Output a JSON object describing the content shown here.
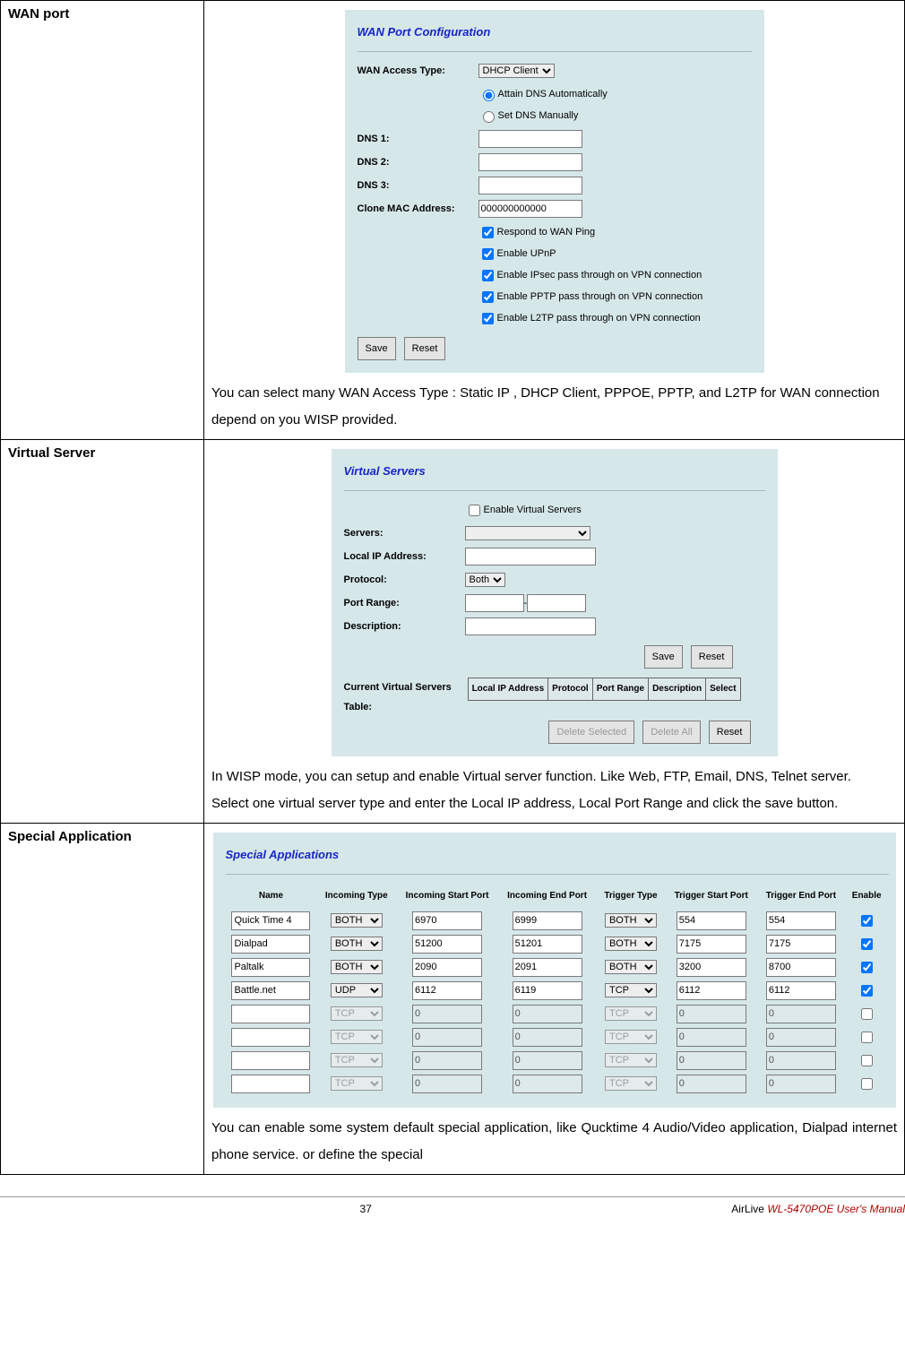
{
  "rows": [
    {
      "label": "WAN port",
      "desc": "You can select many WAN Access Type : Static IP , DHCP Client, PPPOE, PPTP, and L2TP for WAN connection depend on you WISP provided."
    },
    {
      "label": "Virtual Server",
      "desc1": "In WISP mode, you can setup and enable Virtual server function. Like Web, FTP, Email, DNS, Telnet server.",
      "desc2": "Select one virtual server type and enter the Local IP address, Local Port Range and click the save button."
    },
    {
      "label": "Special Application",
      "desc": "You can enable some system default special application, like Qucktime 4 Audio/Video application, Dialpad internet phone service. or define the special"
    }
  ],
  "wan": {
    "title": "WAN Port Configuration",
    "access_label": "WAN Access Type:",
    "access_value": "DHCP Client",
    "radio_auto": "Attain DNS Automatically",
    "radio_manual": "Set DNS Manually",
    "dns1": "DNS 1:",
    "dns2": "DNS 2:",
    "dns3": "DNS 3:",
    "clone_label": "Clone MAC Address:",
    "clone_value": "000000000000",
    "chk1": "Respond to WAN Ping",
    "chk2": "Enable UPnP",
    "chk3": "Enable IPsec pass through on VPN connection",
    "chk4": "Enable PPTP pass through on VPN connection",
    "chk5": "Enable L2TP pass through on VPN connection",
    "save": "Save",
    "reset": "Reset"
  },
  "vs": {
    "title": "Virtual Servers",
    "enable": "Enable Virtual Servers",
    "servers": "Servers:",
    "localip": "Local IP Address:",
    "protocol": "Protocol:",
    "protocol_value": "Both",
    "port": "Port Range:",
    "desc": "Description:",
    "save": "Save",
    "reset": "Reset",
    "table_label": "Current Virtual Servers Table:",
    "th1": "Local IP Address",
    "th2": "Protocol",
    "th3": "Port Range",
    "th4": "Description",
    "th5": "Select",
    "del_sel": "Delete Selected",
    "del_all": "Delete All",
    "reset2": "Reset"
  },
  "sa": {
    "title": "Special Applications",
    "h_name": "Name",
    "h_inc_type": "Incoming Type",
    "h_inc_start": "Incoming Start Port",
    "h_inc_end": "Incoming End Port",
    "h_trig_type": "Trigger Type",
    "h_trig_start": "Trigger Start Port",
    "h_trig_end": "Trigger End Port",
    "h_enable": "Enable",
    "rows": [
      {
        "name": "Quick Time 4",
        "itype": "BOTH",
        "istart": "6970",
        "iend": "6999",
        "ttype": "BOTH",
        "tstart": "554",
        "tend": "554",
        "en": true,
        "editable": true
      },
      {
        "name": "Dialpad",
        "itype": "BOTH",
        "istart": "51200",
        "iend": "51201",
        "ttype": "BOTH",
        "tstart": "7175",
        "tend": "7175",
        "en": true,
        "editable": true
      },
      {
        "name": "Paltalk",
        "itype": "BOTH",
        "istart": "2090",
        "iend": "2091",
        "ttype": "BOTH",
        "tstart": "3200",
        "tend": "8700",
        "en": true,
        "editable": true
      },
      {
        "name": "Battle.net",
        "itype": "UDP",
        "istart": "6112",
        "iend": "6119",
        "ttype": "TCP",
        "tstart": "6112",
        "tend": "6112",
        "en": true,
        "editable": true
      },
      {
        "name": "",
        "itype": "TCP",
        "istart": "0",
        "iend": "0",
        "ttype": "TCP",
        "tstart": "0",
        "tend": "0",
        "en": false,
        "editable": false
      },
      {
        "name": "",
        "itype": "TCP",
        "istart": "0",
        "iend": "0",
        "ttype": "TCP",
        "tstart": "0",
        "tend": "0",
        "en": false,
        "editable": false
      },
      {
        "name": "",
        "itype": "TCP",
        "istart": "0",
        "iend": "0",
        "ttype": "TCP",
        "tstart": "0",
        "tend": "0",
        "en": false,
        "editable": false
      },
      {
        "name": "",
        "itype": "TCP",
        "istart": "0",
        "iend": "0",
        "ttype": "TCP",
        "tstart": "0",
        "tend": "0",
        "en": false,
        "editable": false
      }
    ]
  },
  "footer": {
    "page": "37",
    "brand": "AirLive ",
    "product": "WL-5470POE User's Manual"
  }
}
